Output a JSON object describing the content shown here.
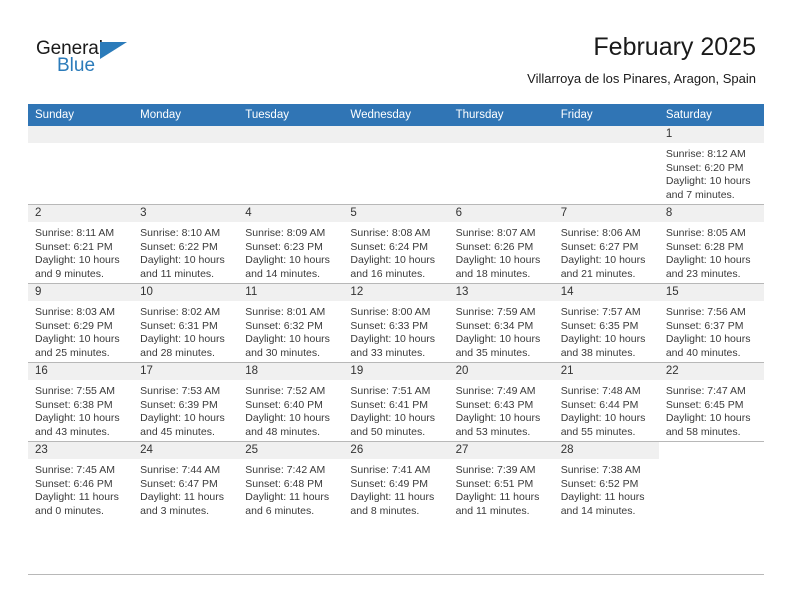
{
  "brand": {
    "name_top": "General",
    "name_bottom": "Blue",
    "accent_color": "#2b7bba"
  },
  "header": {
    "month_title": "February 2025",
    "location": "Villarroya de los Pinares, Aragon, Spain"
  },
  "calendar": {
    "header_bg": "#3075b5",
    "daynum_band_bg": "#f0f0f0",
    "grid_line_color": "#b8b8b8",
    "weekday_headers": [
      "Sunday",
      "Monday",
      "Tuesday",
      "Wednesday",
      "Thursday",
      "Friday",
      "Saturday"
    ],
    "weeks": [
      [
        {
          "day": "",
          "lines": []
        },
        {
          "day": "",
          "lines": []
        },
        {
          "day": "",
          "lines": []
        },
        {
          "day": "",
          "lines": []
        },
        {
          "day": "",
          "lines": []
        },
        {
          "day": "",
          "lines": []
        },
        {
          "day": "1",
          "lines": [
            "Sunrise: 8:12 AM",
            "Sunset: 6:20 PM",
            "Daylight: 10 hours",
            "and 7 minutes."
          ]
        }
      ],
      [
        {
          "day": "2",
          "lines": [
            "Sunrise: 8:11 AM",
            "Sunset: 6:21 PM",
            "Daylight: 10 hours",
            "and 9 minutes."
          ]
        },
        {
          "day": "3",
          "lines": [
            "Sunrise: 8:10 AM",
            "Sunset: 6:22 PM",
            "Daylight: 10 hours",
            "and 11 minutes."
          ]
        },
        {
          "day": "4",
          "lines": [
            "Sunrise: 8:09 AM",
            "Sunset: 6:23 PM",
            "Daylight: 10 hours",
            "and 14 minutes."
          ]
        },
        {
          "day": "5",
          "lines": [
            "Sunrise: 8:08 AM",
            "Sunset: 6:24 PM",
            "Daylight: 10 hours",
            "and 16 minutes."
          ]
        },
        {
          "day": "6",
          "lines": [
            "Sunrise: 8:07 AM",
            "Sunset: 6:26 PM",
            "Daylight: 10 hours",
            "and 18 minutes."
          ]
        },
        {
          "day": "7",
          "lines": [
            "Sunrise: 8:06 AM",
            "Sunset: 6:27 PM",
            "Daylight: 10 hours",
            "and 21 minutes."
          ]
        },
        {
          "day": "8",
          "lines": [
            "Sunrise: 8:05 AM",
            "Sunset: 6:28 PM",
            "Daylight: 10 hours",
            "and 23 minutes."
          ]
        }
      ],
      [
        {
          "day": "9",
          "lines": [
            "Sunrise: 8:03 AM",
            "Sunset: 6:29 PM",
            "Daylight: 10 hours",
            "and 25 minutes."
          ]
        },
        {
          "day": "10",
          "lines": [
            "Sunrise: 8:02 AM",
            "Sunset: 6:31 PM",
            "Daylight: 10 hours",
            "and 28 minutes."
          ]
        },
        {
          "day": "11",
          "lines": [
            "Sunrise: 8:01 AM",
            "Sunset: 6:32 PM",
            "Daylight: 10 hours",
            "and 30 minutes."
          ]
        },
        {
          "day": "12",
          "lines": [
            "Sunrise: 8:00 AM",
            "Sunset: 6:33 PM",
            "Daylight: 10 hours",
            "and 33 minutes."
          ]
        },
        {
          "day": "13",
          "lines": [
            "Sunrise: 7:59 AM",
            "Sunset: 6:34 PM",
            "Daylight: 10 hours",
            "and 35 minutes."
          ]
        },
        {
          "day": "14",
          "lines": [
            "Sunrise: 7:57 AM",
            "Sunset: 6:35 PM",
            "Daylight: 10 hours",
            "and 38 minutes."
          ]
        },
        {
          "day": "15",
          "lines": [
            "Sunrise: 7:56 AM",
            "Sunset: 6:37 PM",
            "Daylight: 10 hours",
            "and 40 minutes."
          ]
        }
      ],
      [
        {
          "day": "16",
          "lines": [
            "Sunrise: 7:55 AM",
            "Sunset: 6:38 PM",
            "Daylight: 10 hours",
            "and 43 minutes."
          ]
        },
        {
          "day": "17",
          "lines": [
            "Sunrise: 7:53 AM",
            "Sunset: 6:39 PM",
            "Daylight: 10 hours",
            "and 45 minutes."
          ]
        },
        {
          "day": "18",
          "lines": [
            "Sunrise: 7:52 AM",
            "Sunset: 6:40 PM",
            "Daylight: 10 hours",
            "and 48 minutes."
          ]
        },
        {
          "day": "19",
          "lines": [
            "Sunrise: 7:51 AM",
            "Sunset: 6:41 PM",
            "Daylight: 10 hours",
            "and 50 minutes."
          ]
        },
        {
          "day": "20",
          "lines": [
            "Sunrise: 7:49 AM",
            "Sunset: 6:43 PM",
            "Daylight: 10 hours",
            "and 53 minutes."
          ]
        },
        {
          "day": "21",
          "lines": [
            "Sunrise: 7:48 AM",
            "Sunset: 6:44 PM",
            "Daylight: 10 hours",
            "and 55 minutes."
          ]
        },
        {
          "day": "22",
          "lines": [
            "Sunrise: 7:47 AM",
            "Sunset: 6:45 PM",
            "Daylight: 10 hours",
            "and 58 minutes."
          ]
        }
      ],
      [
        {
          "day": "23",
          "lines": [
            "Sunrise: 7:45 AM",
            "Sunset: 6:46 PM",
            "Daylight: 11 hours",
            "and 0 minutes."
          ]
        },
        {
          "day": "24",
          "lines": [
            "Sunrise: 7:44 AM",
            "Sunset: 6:47 PM",
            "Daylight: 11 hours",
            "and 3 minutes."
          ]
        },
        {
          "day": "25",
          "lines": [
            "Sunrise: 7:42 AM",
            "Sunset: 6:48 PM",
            "Daylight: 11 hours",
            "and 6 minutes."
          ]
        },
        {
          "day": "26",
          "lines": [
            "Sunrise: 7:41 AM",
            "Sunset: 6:49 PM",
            "Daylight: 11 hours",
            "and 8 minutes."
          ]
        },
        {
          "day": "27",
          "lines": [
            "Sunrise: 7:39 AM",
            "Sunset: 6:51 PM",
            "Daylight: 11 hours",
            "and 11 minutes."
          ]
        },
        {
          "day": "28",
          "lines": [
            "Sunrise: 7:38 AM",
            "Sunset: 6:52 PM",
            "Daylight: 11 hours",
            "and 14 minutes."
          ]
        },
        {
          "day": "",
          "lines": []
        }
      ]
    ]
  }
}
